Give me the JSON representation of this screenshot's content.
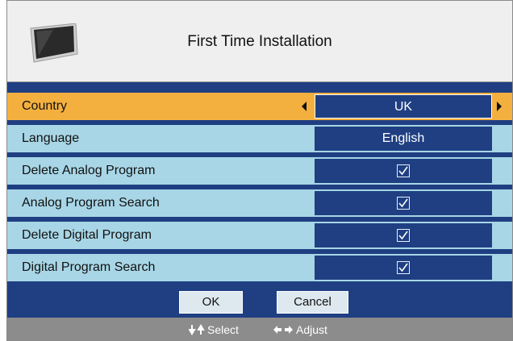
{
  "header": {
    "title": "First Time Installation",
    "icon": "tv-icon"
  },
  "rows": [
    {
      "label": "Country",
      "value": "UK",
      "selected": true
    },
    {
      "label": "Language",
      "value": "English",
      "selected": false
    },
    {
      "label": "Delete Analog Program",
      "value": "checked",
      "selected": false
    },
    {
      "label": "Analog Program Search",
      "value": "checked",
      "selected": false
    },
    {
      "label": "Delete Digital Program",
      "value": "checked",
      "selected": false
    },
    {
      "label": "Digital Program Search",
      "value": "checked",
      "selected": false
    }
  ],
  "buttons": {
    "ok": "OK",
    "cancel": "Cancel"
  },
  "footer": {
    "select": "Select",
    "adjust": "Adjust"
  },
  "colors": {
    "panel": "#1f3f82",
    "row": "#a8d6e6",
    "selected_row": "#f4b03f",
    "footer": "#8c8c8c"
  }
}
